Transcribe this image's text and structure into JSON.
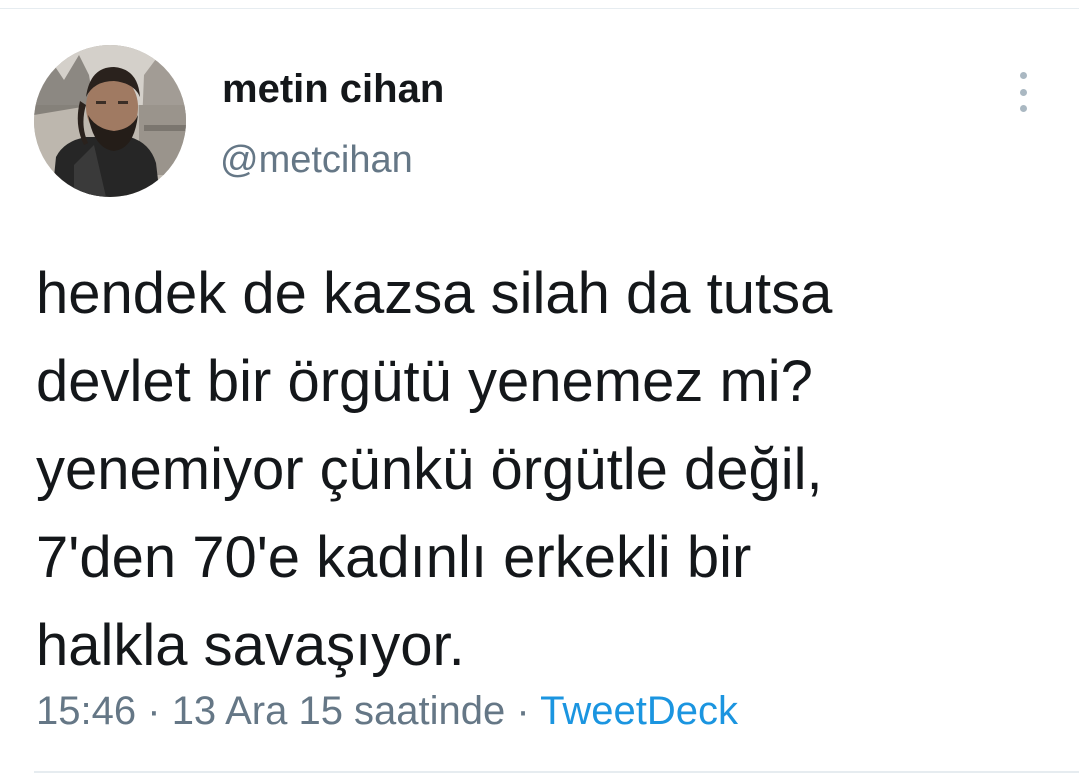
{
  "author": {
    "name": "metin cihan",
    "handle": "@metcihan"
  },
  "tweet": {
    "lines": [
      "hendek de kazsa silah da tutsa",
      "devlet bir örgütü yenemez mi?",
      "yenemiyor çünkü örgütle değil,",
      "7'den 70'e kadınlı erkekli bir",
      "halkla savaşıyor."
    ]
  },
  "meta": {
    "time": "15:46",
    "separator": "·",
    "date": "13 Ara 15 saatinde",
    "source": "TweetDeck"
  },
  "icons": {
    "more": "more-vertical-icon"
  },
  "colors": {
    "text": "#14171a",
    "secondary": "#657786",
    "link": "#1b95e0",
    "divider": "#e6ecf0"
  }
}
